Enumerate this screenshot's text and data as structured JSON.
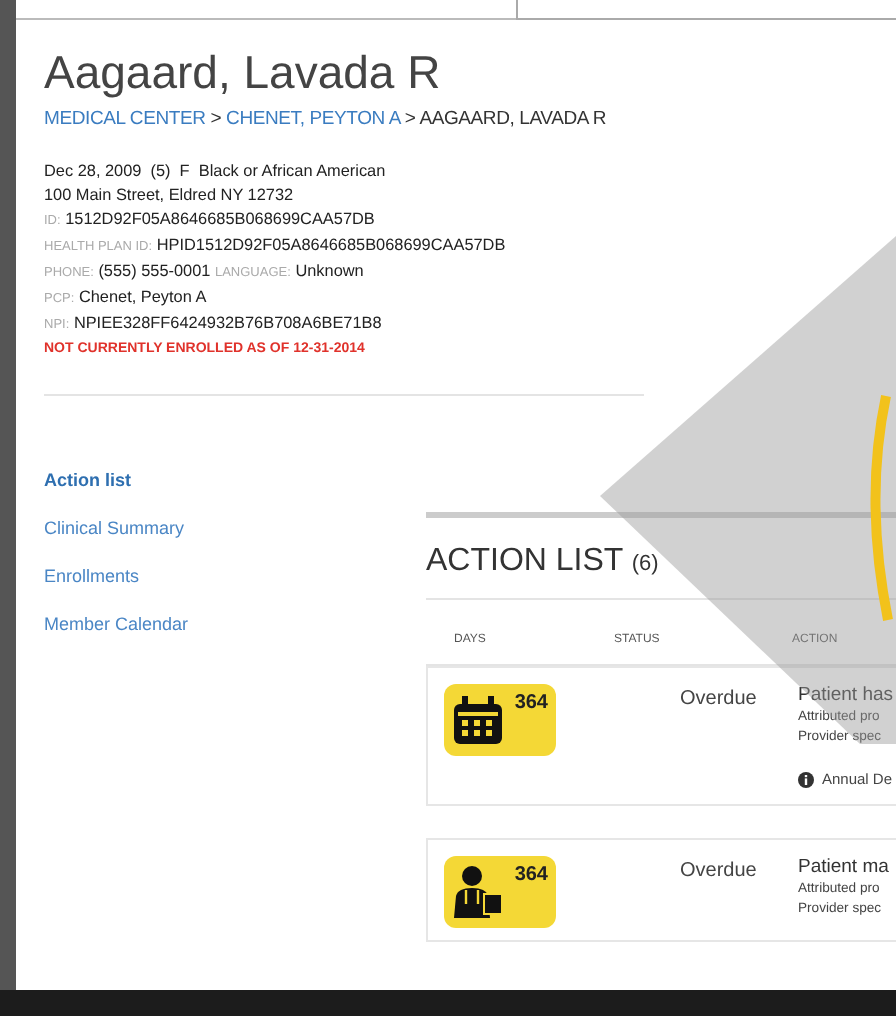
{
  "patient": {
    "name": "Aagaard, Lavada R",
    "breadcrumb": {
      "separator": ">",
      "items": [
        {
          "label": "MEDICAL CENTER",
          "link": true
        },
        {
          "label": "CHENET, PEYTON A",
          "link": true
        },
        {
          "label": "AAGAARD, LAVADA R",
          "link": false
        }
      ]
    },
    "details": [
      [
        {
          "value": "Dec 28, 2009  (5)  F  Black or African American"
        }
      ],
      [
        {
          "value": "100 Main Street, Eldred NY 12732"
        }
      ],
      [
        {
          "label": "ID:",
          "value": "1512D92F05A8646685B068699CAA57DB"
        }
      ],
      [
        {
          "label": "HEALTH PLAN ID:",
          "value": "HPID1512D92F05A8646685B068699CAA57DB"
        }
      ],
      [
        {
          "label": "PHONE:",
          "value": "(555) 555-0001"
        },
        {
          "label": "LANGUAGE:",
          "value": "Unknown"
        }
      ],
      [
        {
          "label": "PCP:",
          "value": "Chenet, Peyton A"
        }
      ],
      [
        {
          "label": "NPI:",
          "value": "NPIEE328FF6424932B76B708A6BE71B8"
        }
      ]
    ],
    "enrollment_notice": "NOT CURRENTLY ENROLLED AS OF 12-31-2014"
  },
  "sidebar": {
    "items": [
      {
        "label": "Action list",
        "selected": true
      },
      {
        "label": "Clinical Summary",
        "selected": false
      },
      {
        "label": "Enrollments",
        "selected": false
      },
      {
        "label": "Member Calendar",
        "selected": false
      }
    ]
  },
  "action_list": {
    "title": "ACTION LIST",
    "count": "(6)",
    "columns": [
      "DAYS",
      "STATUS",
      "ACTION"
    ],
    "rows": [
      {
        "kind": "calendar",
        "days": "364",
        "status": "Overdue",
        "action": "Patient has",
        "details": [
          "Attributed pro",
          "Provider spec"
        ],
        "note": "Annual De"
      },
      {
        "kind": "doctor",
        "days": "364",
        "status": "Overdue",
        "action": "Patient ma",
        "details": [
          "Attributed pro",
          "Provider spec"
        ]
      }
    ]
  }
}
